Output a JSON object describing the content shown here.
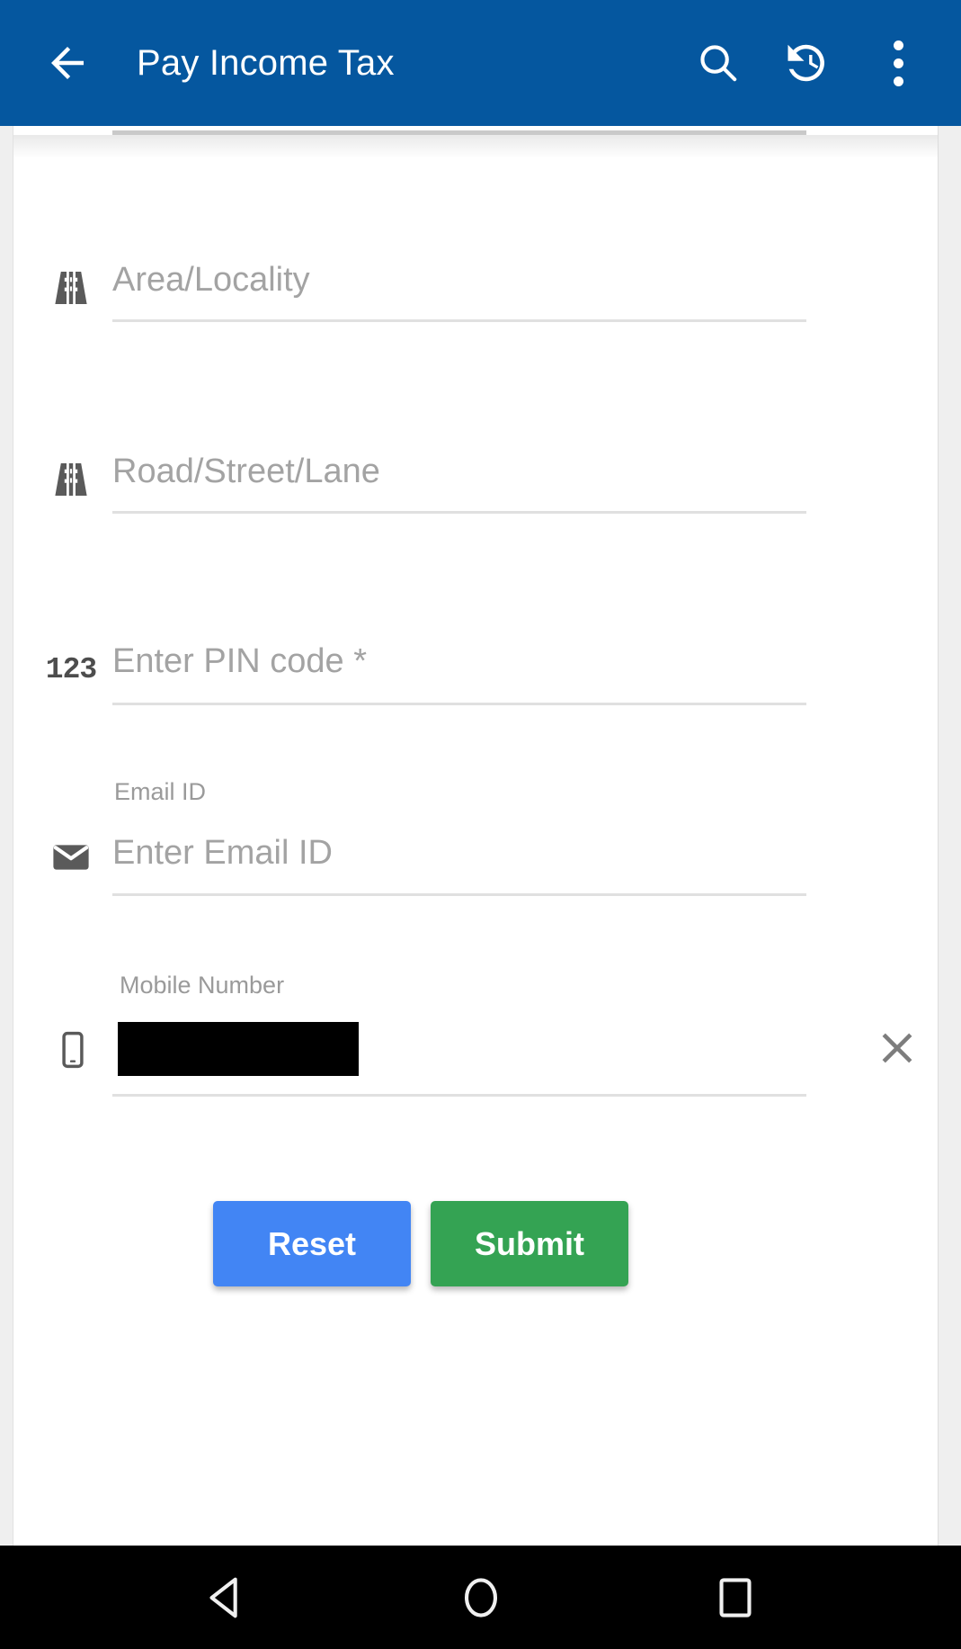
{
  "appbar": {
    "title": "Pay Income Tax",
    "back_icon": "arrow-back-icon",
    "actions": [
      {
        "name": "search-icon",
        "label": "Search"
      },
      {
        "name": "history-icon",
        "label": "History"
      },
      {
        "name": "overflow-menu-icon",
        "label": "More options"
      }
    ]
  },
  "form": {
    "fields": [
      {
        "id": "area_locality",
        "icon": "road-icon",
        "label": "",
        "placeholder": "Area/Locality",
        "value": "",
        "required": false,
        "redacted": false
      },
      {
        "id": "road_street_lane",
        "icon": "road-icon",
        "label": "",
        "placeholder": "Road/Street/Lane",
        "value": "",
        "required": false,
        "redacted": false
      },
      {
        "id": "pin_code",
        "icon": "numbers-123-icon",
        "icon_text": "123",
        "label": "",
        "placeholder": "Enter PIN code *",
        "value": "",
        "required": true,
        "redacted": false
      },
      {
        "id": "email_id",
        "icon": "envelope-icon",
        "label": "Email ID",
        "placeholder": "Enter Email ID",
        "value": "",
        "required": false,
        "redacted": false
      },
      {
        "id": "mobile_number",
        "icon": "mobile-phone-icon",
        "label": "Mobile Number",
        "placeholder": "",
        "value": "",
        "required": false,
        "redacted": true,
        "clear_icon": "clear-x-icon"
      }
    ]
  },
  "actions": {
    "reset_label": "Reset",
    "submit_label": "Submit"
  },
  "navbar": {
    "back": "nav-back-triangle-icon",
    "home": "nav-home-circle-icon",
    "recents": "nav-recents-square-icon"
  },
  "colors": {
    "appbar": "#05579f",
    "reset": "#4285f4",
    "submit": "#34a353",
    "icon_gray": "#5a5a5a",
    "placeholder_gray": "#a3a3a3",
    "underline": "#e0e0e0",
    "navbar": "#000000"
  }
}
